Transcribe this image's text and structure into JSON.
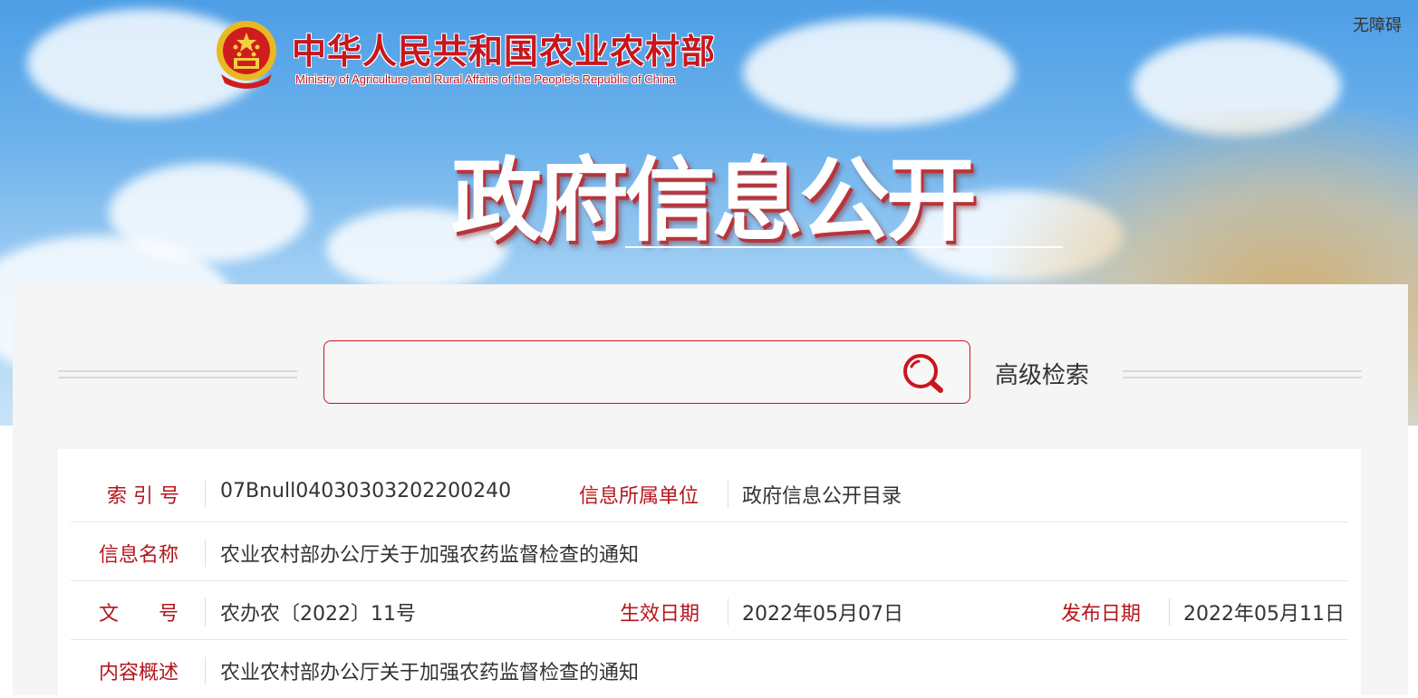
{
  "header": {
    "logo_cn": "中华人民共和国农业农村部",
    "logo_en": "Ministry of Agriculture and Rural Affairs of the People's Republic of China",
    "accessibility": "无障碍",
    "title": "政府信息公开",
    "emblem_icon": "national-emblem-icon"
  },
  "search": {
    "placeholder": "",
    "value": "",
    "icon": "search-icon",
    "advanced_label": "高级检索"
  },
  "info": {
    "row1": {
      "index_label": "索 引 号",
      "index_value": "07Bnull04030303202200240",
      "unit_label": "信息所属单位",
      "unit_value": "政府信息公开目录"
    },
    "row2": {
      "name_label": "信息名称",
      "name_value": "农业农村部办公厅关于加强农药监督检查的通知"
    },
    "row3": {
      "doc_label": "文　　号",
      "doc_value": "农办农〔2022〕11号",
      "effective_label": "生效日期",
      "effective_value": "2022年05月07日",
      "publish_label": "发布日期",
      "publish_value": "2022年05月11日"
    },
    "row4": {
      "summary_label": "内容概述",
      "summary_value": "农业农村部办公厅关于加强农药监督检查的通知"
    }
  },
  "colors": {
    "accent": "#c8161d",
    "label": "#b5161c",
    "panel_bg": "#f5f5f5"
  }
}
